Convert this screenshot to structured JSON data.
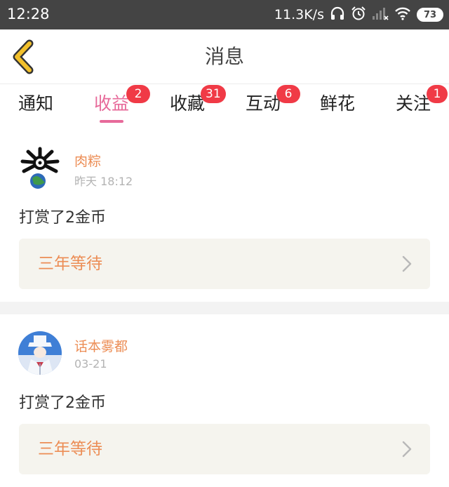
{
  "status_bar": {
    "time": "12:28",
    "network_speed": "11.3K/s",
    "battery": "73",
    "icons": [
      "headset-icon",
      "alarm-icon",
      "signal-icon",
      "wifi-icon",
      "battery-icon"
    ]
  },
  "header": {
    "title": "消息",
    "back_icon": "chevron-left-icon",
    "accent_color": "#f2c02b"
  },
  "tabs": [
    {
      "label": "通知",
      "badge": "",
      "active": false
    },
    {
      "label": "收益",
      "badge": "2",
      "active": true
    },
    {
      "label": "收藏",
      "badge": "31",
      "active": false
    },
    {
      "label": "互动",
      "badge": "6",
      "active": false
    },
    {
      "label": "鲜花",
      "badge": "",
      "active": false
    },
    {
      "label": "关注",
      "badge": "1",
      "active": false
    }
  ],
  "colors": {
    "active_tab": "#e76a9a",
    "badge": "#f03a46",
    "username": "#ec8d55",
    "quote_bg": "#f5f4ee"
  },
  "feed": [
    {
      "username": "肉粽",
      "time": "昨天 18:12",
      "message": "打赏了2金币",
      "work_title": "三年等待"
    },
    {
      "username": "话本雾都",
      "time": "03-21",
      "message": "打赏了2金币",
      "work_title": "三年等待"
    }
  ]
}
